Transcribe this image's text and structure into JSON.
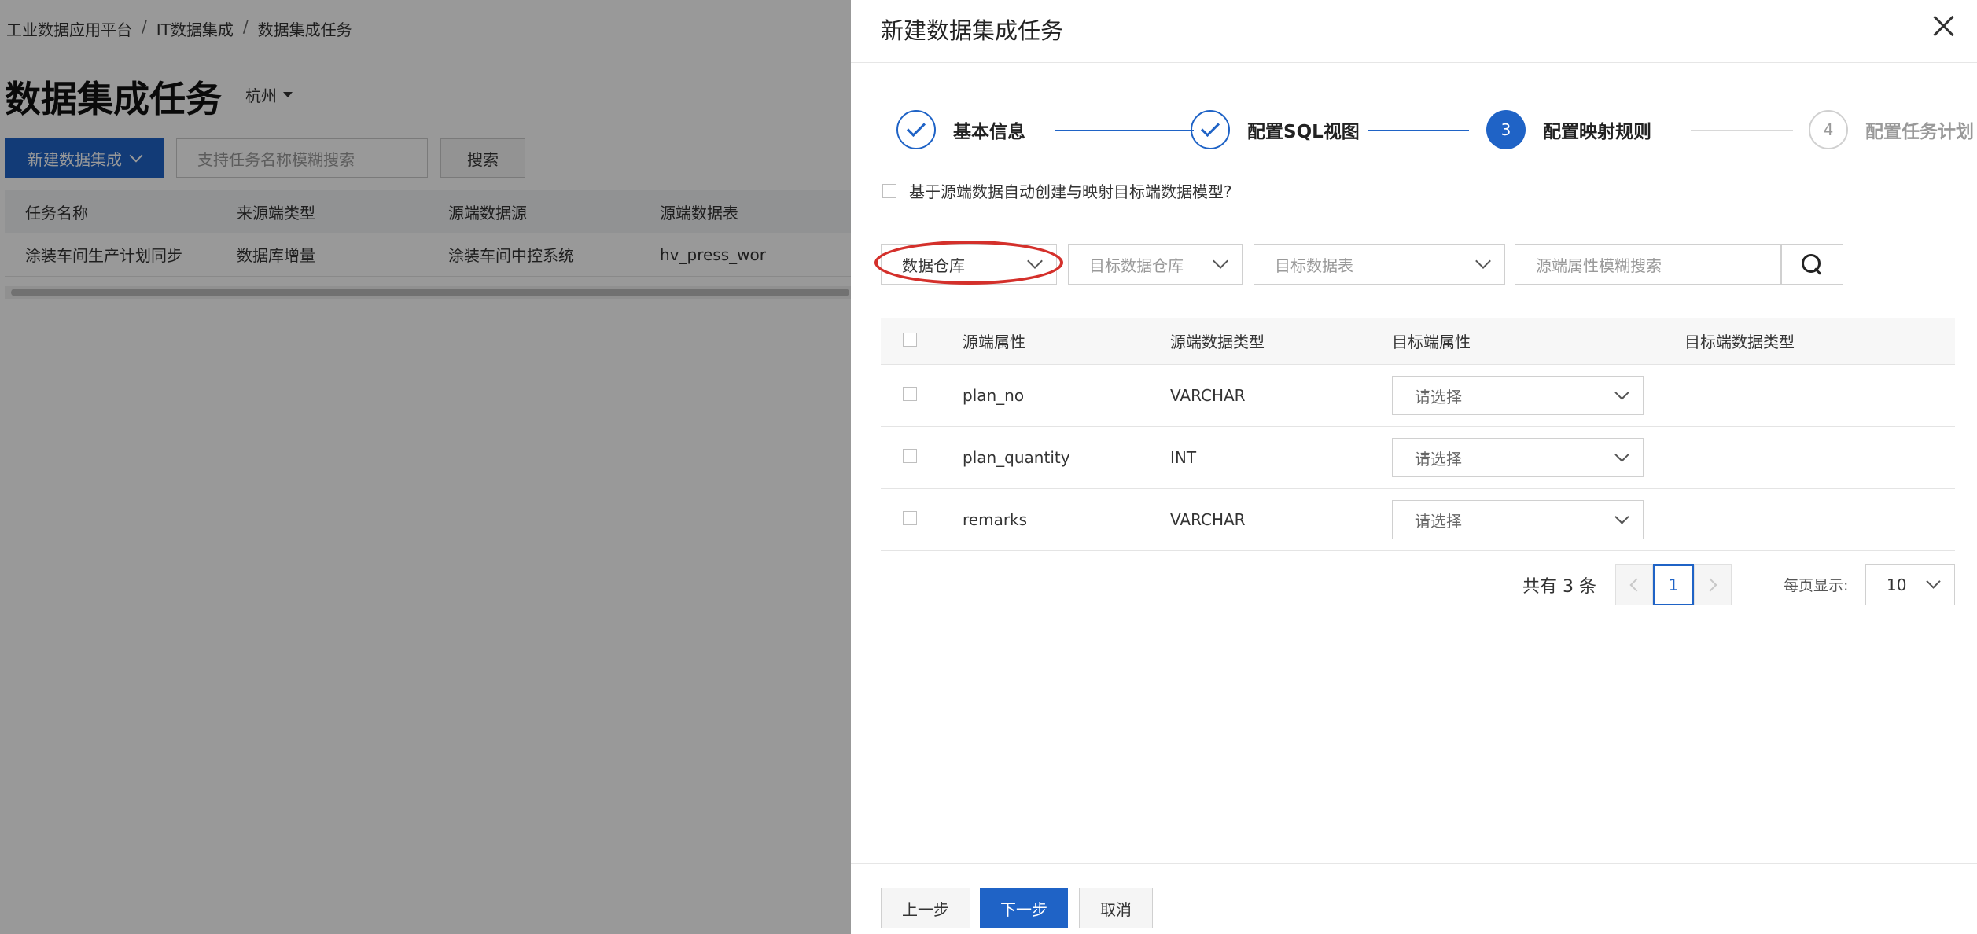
{
  "breadcrumb": [
    "工业数据应用平台",
    "IT数据集成",
    "数据集成任务"
  ],
  "page": {
    "title": "数据集成任务",
    "region": "杭州",
    "new_button": "新建数据集成",
    "search_placeholder": "支持任务名称模糊搜索",
    "search_button": "搜索"
  },
  "task_table": {
    "columns": [
      "任务名称",
      "来源端类型",
      "源端数据源",
      "源端数据表"
    ],
    "rows": [
      [
        "涂装车间生产计划同步",
        "数据库增量",
        "涂装车间中控系统",
        "hv_press_wor"
      ]
    ]
  },
  "drawer": {
    "title": "新建数据集成任务",
    "steps": [
      {
        "label": "基本信息",
        "status": "done",
        "number": ""
      },
      {
        "label": "配置SQL视图",
        "status": "done",
        "number": ""
      },
      {
        "label": "配置映射规则",
        "status": "active",
        "number": "3"
      },
      {
        "label": "配置任务计划",
        "status": "todo",
        "number": "4"
      }
    ],
    "auto_create_label": "基于源端数据自动创建与映射目标端数据模型?",
    "filters": {
      "target_type": "数据仓库",
      "target_warehouse_placeholder": "目标数据仓库",
      "target_table_placeholder": "目标数据表",
      "search_placeholder": "源端属性模糊搜索"
    },
    "mapping_table": {
      "columns": [
        "源端属性",
        "源端数据类型",
        "目标端属性",
        "目标端数据类型"
      ],
      "select_placeholder": "请选择",
      "rows": [
        {
          "source_attr": "plan_no",
          "source_type": "VARCHAR",
          "target_attr": "请选择",
          "target_type": ""
        },
        {
          "source_attr": "plan_quantity",
          "source_type": "INT",
          "target_attr": "请选择",
          "target_type": ""
        },
        {
          "source_attr": "remarks",
          "source_type": "VARCHAR",
          "target_attr": "请选择",
          "target_type": ""
        }
      ]
    },
    "pagination": {
      "total_label": "共有 3 条",
      "current_page": "1",
      "per_page_label": "每页显示:",
      "per_page_value": "10"
    },
    "footer": {
      "prev": "上一步",
      "next": "下一步",
      "cancel": "取消"
    }
  },
  "colors": {
    "primary": "#1f63c6",
    "highlight": "#d4302b"
  }
}
